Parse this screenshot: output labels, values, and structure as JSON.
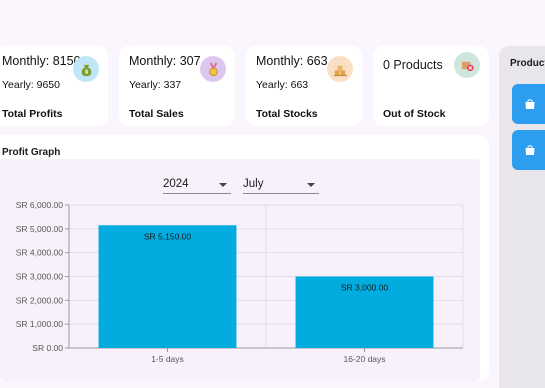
{
  "cards": [
    {
      "monthly": "Monthly: 8150",
      "yearly": "Yearly: 9650",
      "label": "Total Profits",
      "icon": "money-bag-icon"
    },
    {
      "monthly": "Monthly: 307",
      "yearly": "Yearly: 337",
      "label": "Total Sales",
      "icon": "medal-icon"
    },
    {
      "monthly": "Monthly: 663",
      "yearly": "Yearly: 663",
      "label": "Total Stocks",
      "icon": "stock-boxes-icon"
    },
    {
      "big": "0 Products",
      "label": "Out of Stock",
      "icon": "out-of-stock-icon"
    }
  ],
  "graph": {
    "title": "Profit Graph",
    "year": "2024",
    "month": "July"
  },
  "side": {
    "title": "Product"
  },
  "colors": {
    "bar": "#03acdf",
    "accent": "#2d9df0"
  },
  "chart_data": {
    "type": "bar",
    "categories": [
      "1-5 days",
      "16-20 days"
    ],
    "values": [
      5150,
      3000
    ],
    "value_labels": [
      "SR 5,150.00",
      "SR 3,000.00"
    ],
    "ylim": [
      0,
      6000
    ],
    "yticks": [
      0,
      1000,
      2000,
      3000,
      4000,
      5000,
      6000
    ],
    "ytick_labels": [
      "SR 0.00",
      "SR 1,000.00",
      "SR 2,000.00",
      "SR 3,000.00",
      "SR 4,000.00",
      "SR 5,000.00",
      "SR 6,000.00"
    ],
    "grid": true
  }
}
